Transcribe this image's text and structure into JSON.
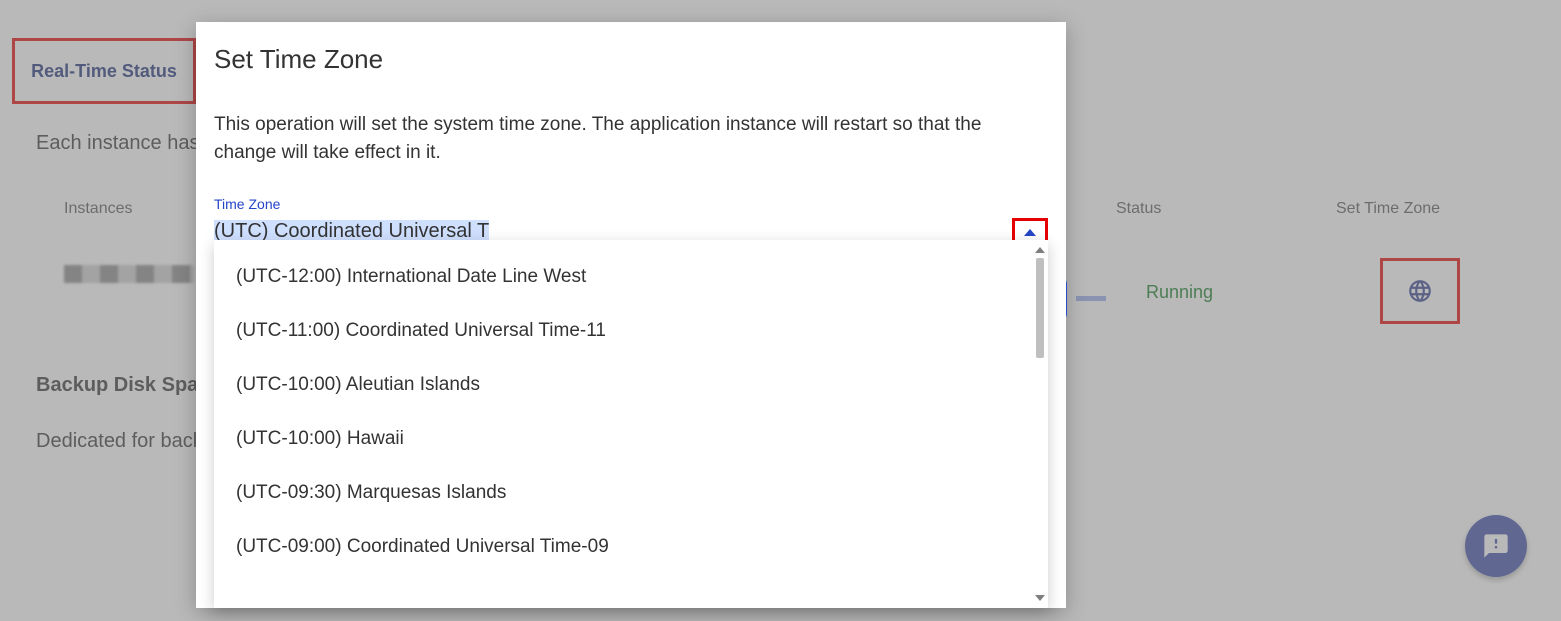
{
  "page": {
    "realtime_tab": "Real-Time Status",
    "instance_sub_visible": "Each instance has",
    "headers": {
      "instances": "Instances",
      "status": "Status",
      "timezone": "Set Time Zone"
    },
    "row": {
      "status": "Running"
    },
    "backup_heading_visible": "Backup Disk Space",
    "backup_sub_visible": "Dedicated for backu"
  },
  "modal": {
    "title": "Set Time Zone",
    "description": "This operation will set the system time zone. The application instance will restart so that the change will take effect in it.",
    "field_label": "Time Zone",
    "selected_value": "(UTC) Coordinated Universal T",
    "options": [
      "(UTC-12:00) International Date Line West",
      "(UTC-11:00) Coordinated Universal Time-11",
      "(UTC-10:00) Aleutian Islands",
      "(UTC-10:00) Hawaii",
      "(UTC-09:30) Marquesas Islands",
      "(UTC-09:00) Coordinated Universal Time-09"
    ]
  },
  "icons": {
    "globe": "globe-icon",
    "chevron_up": "chevron-up-icon",
    "feedback": "feedback-icon"
  }
}
